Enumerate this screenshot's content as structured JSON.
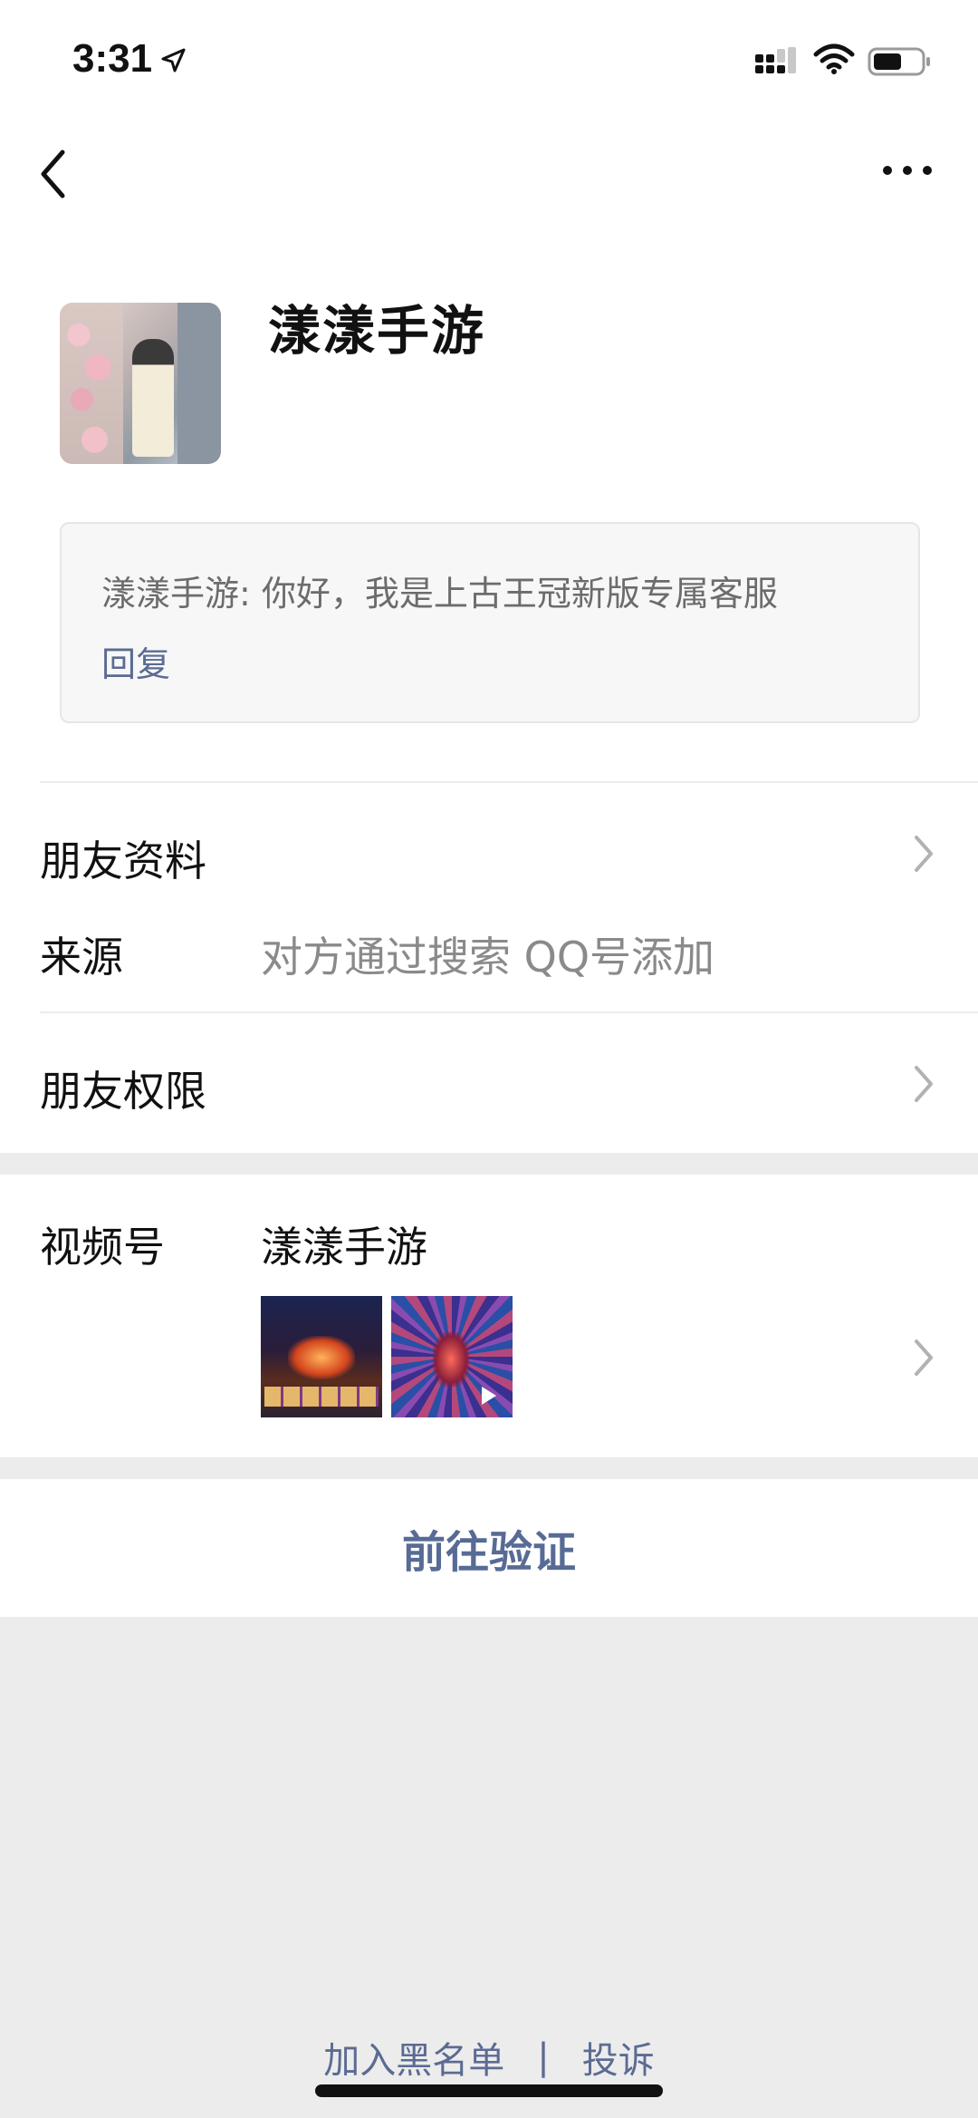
{
  "status_bar": {
    "time": "3:31"
  },
  "profile": {
    "name": "漾漾手游",
    "message": {
      "text": "漾漾手游: 你好，我是上古王冠新版专属客服",
      "reply_label": "回复"
    }
  },
  "rows": {
    "friend_info": "朋友资料",
    "source_label": "来源",
    "source_value": "对方通过搜索 QQ号添加",
    "friend_permissions": "朋友权限",
    "channels_label": "视频号",
    "channels_value": "漾漾手游"
  },
  "actions": {
    "verify": "前往验证",
    "blacklist": "加入黑名单",
    "separator": "|",
    "report": "投诉"
  },
  "colors": {
    "link": "#576b95",
    "background": "#ececec"
  },
  "icons": [
    "location-arrow-icon",
    "signal-icon",
    "wifi-icon",
    "battery-icon",
    "back-icon",
    "more-icon",
    "chevron-right-icon",
    "play-icon"
  ]
}
